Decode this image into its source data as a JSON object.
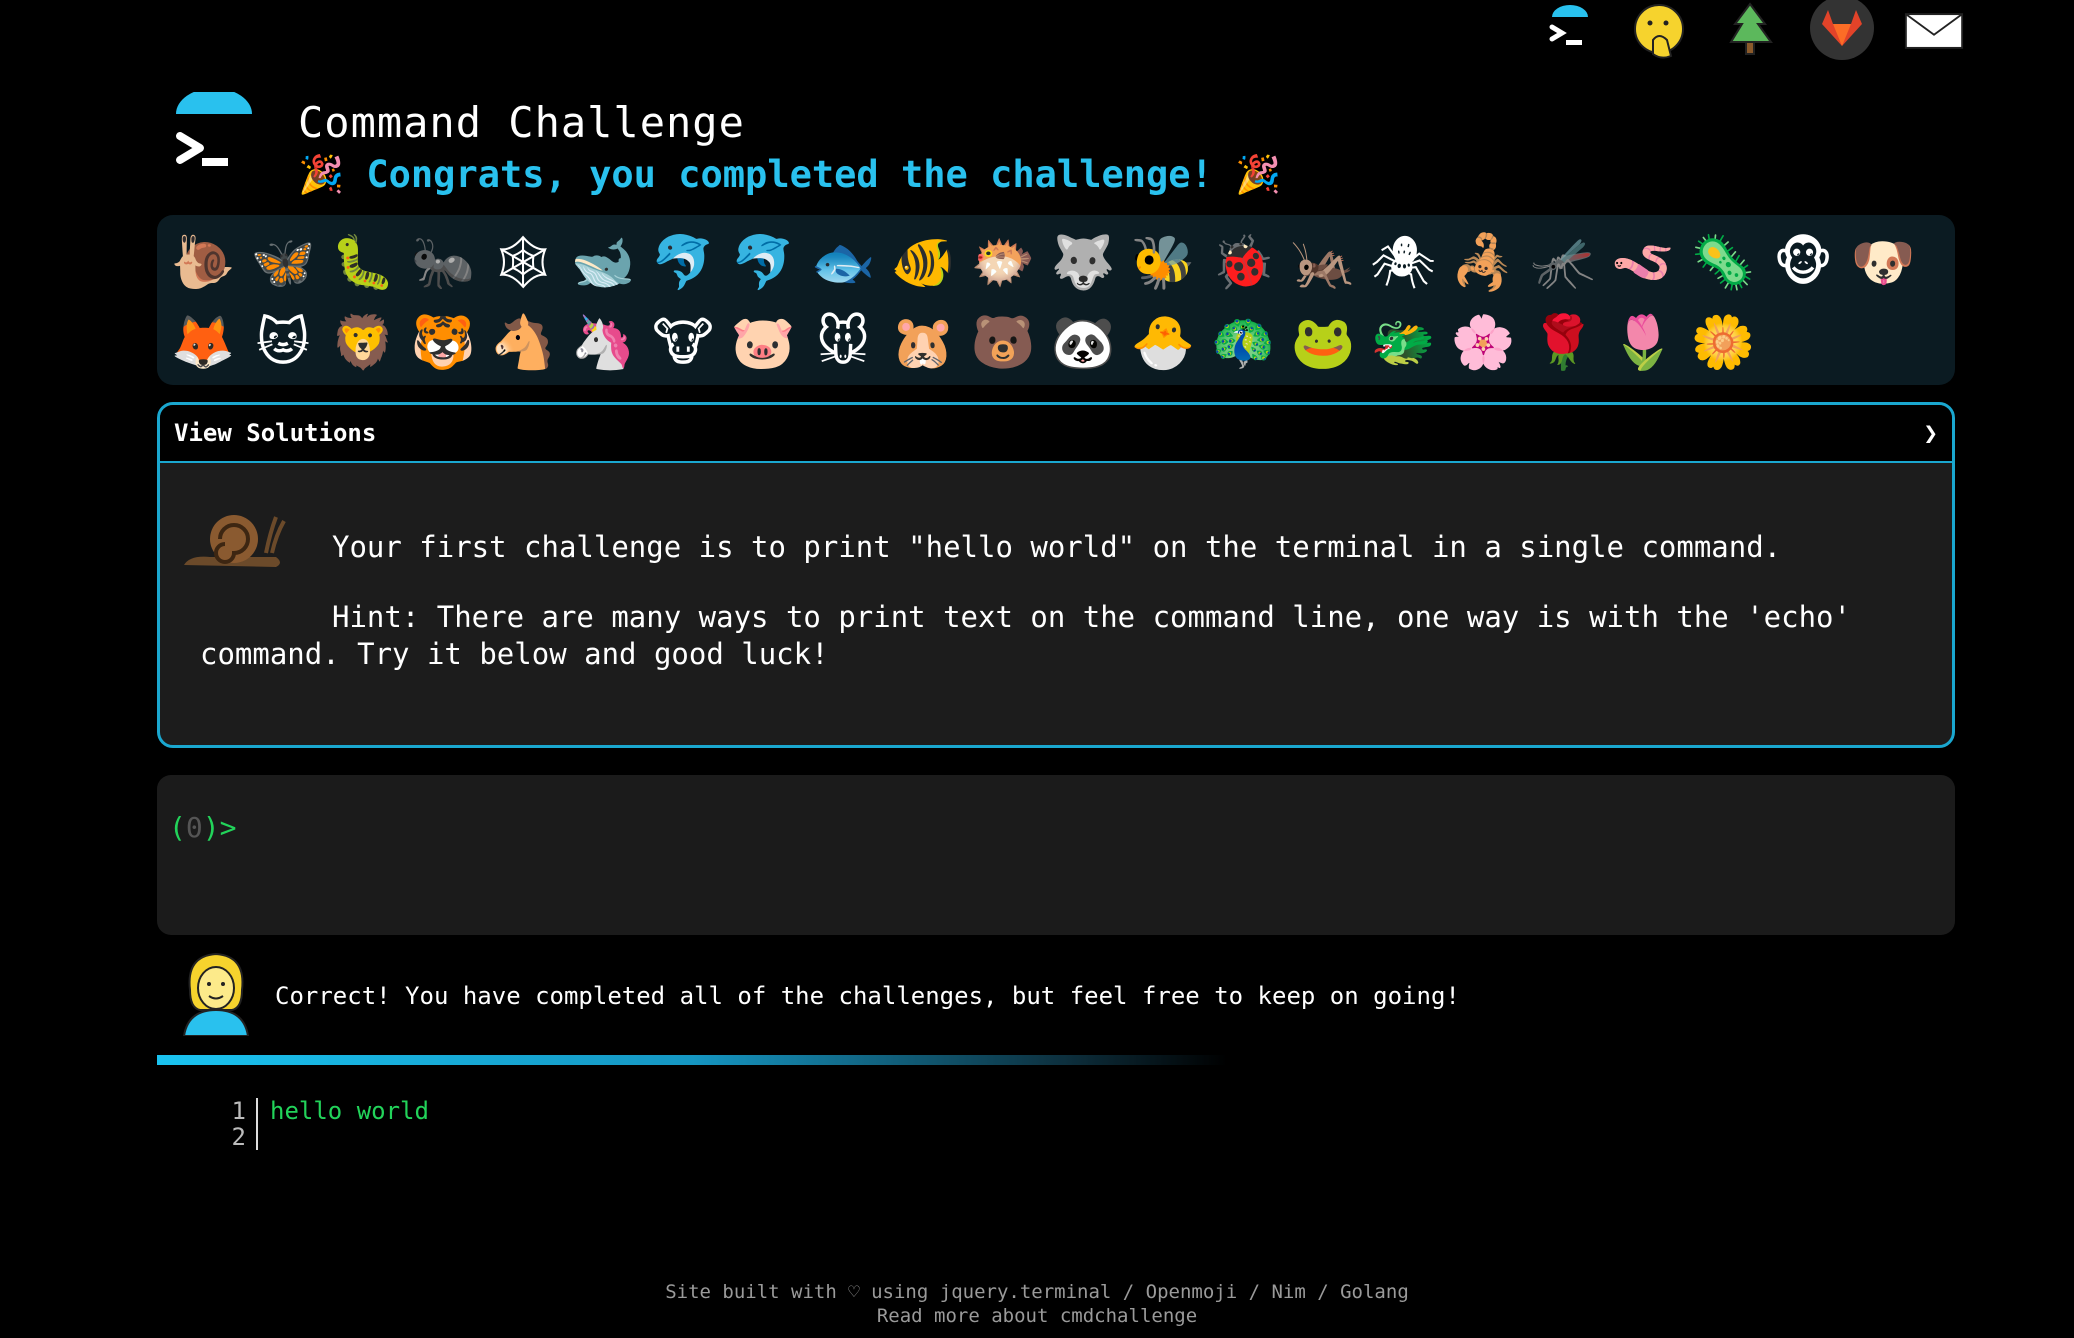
{
  "topnav": {
    "icons": [
      "terminal-logo-icon",
      "face-with-hand-over-mouth-icon",
      "evergreen-tree-icon",
      "gitlab-icon",
      "envelope-icon"
    ]
  },
  "header": {
    "title": "Command Challenge",
    "subtitle": "Congrats, you completed the challenge!",
    "party_left": "🎉",
    "party_right": "🎉"
  },
  "emoji_grid": {
    "row1": [
      "🐌",
      "🦋",
      "🐛",
      "🐜",
      "🕸",
      "🐋",
      "🐬",
      "🐬",
      "🐟",
      "🐠",
      "🐡",
      "🐺",
      "🐝",
      "🐞",
      "🦗",
      "🕷",
      "🦂",
      "🦟",
      "🪱",
      "🦠",
      "🐵",
      "🐶"
    ],
    "row2": [
      "🦊",
      "🐱",
      "🦁",
      "🐯",
      "🐴",
      "🦄",
      "🐮",
      "🐷",
      "🐭",
      "🐹",
      "🐻",
      "🐼",
      "🐣",
      "🦚",
      "🐸",
      "🐲",
      "🌸",
      "🌹",
      "🌷",
      "🌼"
    ]
  },
  "panel": {
    "header_label": "View Solutions",
    "chevron": "❯",
    "challenge": "Your first challenge is to print \"hello world\" on the terminal in a single command.",
    "hint": "Hint: There are many ways to print text on the command line, one way is with the 'echo' command. Try it below and good luck!"
  },
  "terminal": {
    "prompt_open": "(",
    "prompt_count": "0",
    "prompt_close": ")>"
  },
  "feedback": {
    "message": "Correct! You have completed all of the challenges, but feel free to keep on going!",
    "progress": 1.0
  },
  "output": {
    "lines": [
      {
        "num": "1",
        "text": "hello world"
      },
      {
        "num": "2",
        "text": ""
      }
    ]
  },
  "footer": {
    "line1": "Site built with ♡ using jquery.terminal / Openmoji / Nim / Golang",
    "line2": "Read more about cmdchallenge"
  },
  "colors": {
    "accent": "#29c1ee",
    "prompt_green": "#22d35a",
    "panel_border": "#1aa7cf"
  }
}
